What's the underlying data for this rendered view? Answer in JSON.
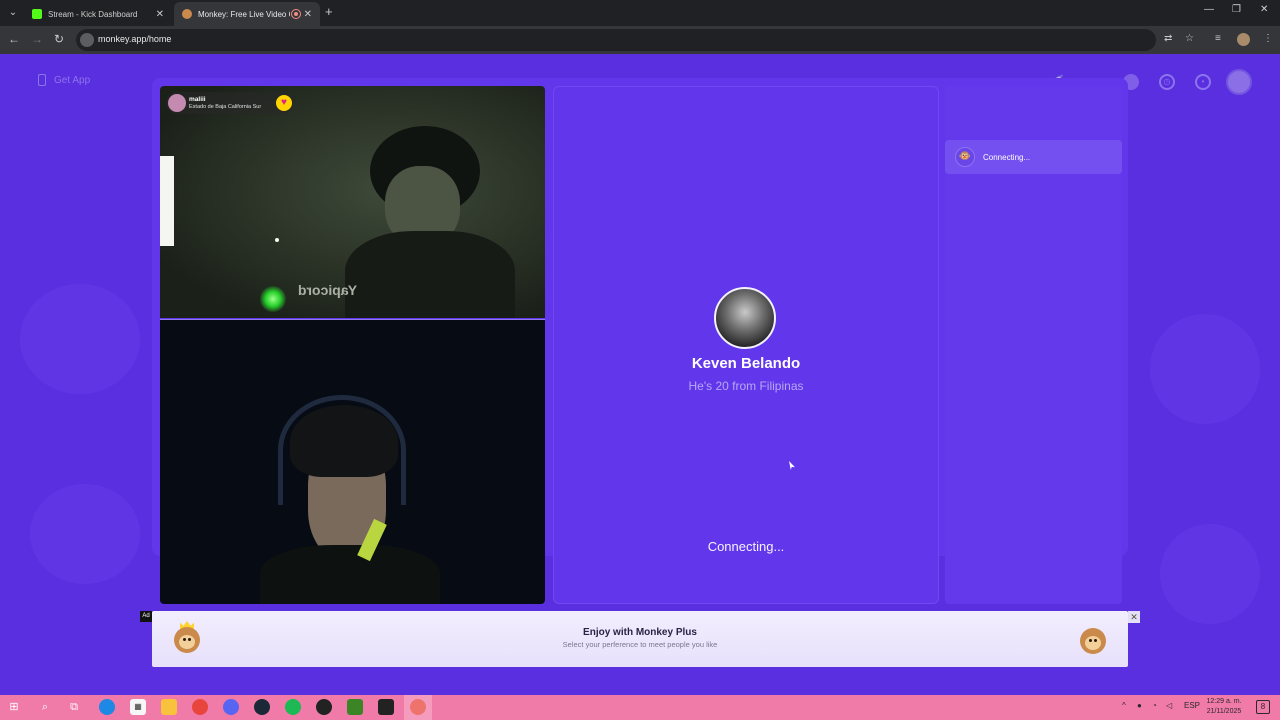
{
  "browser": {
    "tabs": [
      {
        "title": "Stream - Kick Dashboard",
        "favicon_color": "#53fc18"
      },
      {
        "title": "Monkey: Free Live Video Ch",
        "favicon_color": "#c98a4b"
      }
    ],
    "new_tab_symbol": "+",
    "url": "monkey.app/home",
    "icons": [
      "back-icon",
      "forward-icon",
      "reload-icon",
      "translate-icon",
      "star-icon",
      "extensions-icon",
      "menu-icon"
    ]
  },
  "header": {
    "get_app_label": "Get App",
    "icons": [
      "coins-icon",
      "search-icon",
      "gem-icon",
      "history-icon",
      "chat-icon",
      "avatar-icon"
    ]
  },
  "peer_video": {
    "name": "maliii",
    "location": "Estado de Baja California Sur",
    "mirrored_text": "Yapicord"
  },
  "match": {
    "name": "Keven Belando",
    "subtitle": "He's 20 from Filipinas",
    "status": "Connecting..."
  },
  "chat_list": {
    "item_label": "Connecting..."
  },
  "ad": {
    "badge": "Ad",
    "title": "Enjoy with Monkey Plus",
    "subtitle": "Select your perference to meet people you like",
    "close": "✕"
  },
  "taskbar": {
    "language": "ESP",
    "time": "12:29 a. m.",
    "date": "21/11/2025",
    "notification_count": "8"
  },
  "colors": {
    "page_bg": "#5a2fe0",
    "panel": "#6236eb",
    "taskbar": "#f07aa8"
  }
}
